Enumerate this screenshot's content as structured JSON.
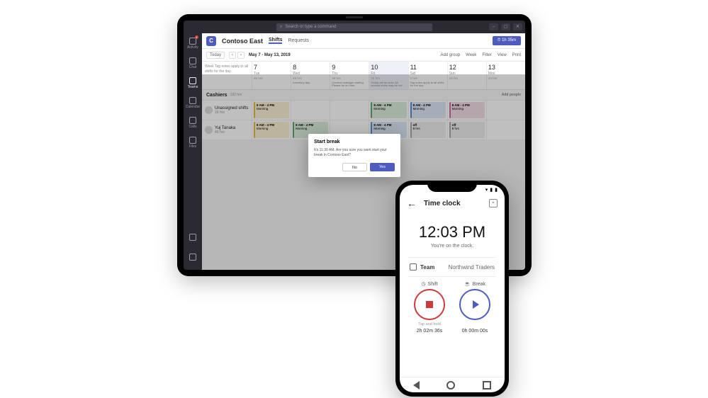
{
  "titlebar": {
    "search_placeholder": "Search or type a command"
  },
  "rail": {
    "items": [
      "Activity",
      "Chat",
      "Teams",
      "Calendar",
      "Calls",
      "Files"
    ],
    "badge": "1"
  },
  "header": {
    "team_initial": "C",
    "team_name": "Contoso East",
    "tabs": [
      "Shifts",
      "Requests"
    ],
    "clock_btn": "⏱ 1h 35m"
  },
  "toolbar": {
    "today": "Today",
    "date_range": "May 7 - May 13, 2019",
    "right": [
      "Add group",
      "Week",
      "Filter",
      "View",
      "Print"
    ]
  },
  "days_label": "Week\nTag notes apply to all shifts for the day",
  "days": [
    {
      "n": "7",
      "w": "Tue",
      "hrs": "48 hrs",
      "note": ""
    },
    {
      "n": "8",
      "w": "Wed",
      "hrs": "48 hrs",
      "note": "Inventory day."
    },
    {
      "n": "9",
      "w": "Thu",
      "hrs": "48 hrs",
      "note": "General manager visiting. Please be on time."
    },
    {
      "n": "10",
      "w": "Fri",
      "hrs": "32 hrs",
      "note": "Today will be slow. All second shifts may be cut.",
      "sel": true
    },
    {
      "n": "11",
      "w": "Sat",
      "hrs": "0 hrs",
      "note": "Tag notes apply to all shifts for the day"
    },
    {
      "n": "12",
      "w": "Sun",
      "hrs": "24 hrs",
      "note": ""
    },
    {
      "n": "13",
      "w": "Mon",
      "hrs": "24 hrs",
      "note": ""
    }
  ],
  "group": {
    "name": "Cashiers",
    "hours": "192 hrs",
    "add": "Add people"
  },
  "rows": [
    {
      "label": "Unassigned shifts",
      "sub": "16 hrs",
      "cells": [
        {
          "t": "8 AM - 4 PM",
          "s": "Morning",
          "c": "s-yellow"
        },
        null,
        null,
        {
          "t": "8 AM - 4 PM",
          "s": "Morning",
          "c": "s-green"
        },
        {
          "t": "8 AM - 4 PM",
          "s": "Morning",
          "c": "s-blue"
        },
        {
          "t": "8 AM - 4 PM",
          "s": "Morning",
          "c": "s-pink"
        },
        null
      ]
    },
    {
      "label": "Yuj Tanaka",
      "sub": "40 hrs",
      "cells": [
        {
          "t": "8 AM - 4 PM",
          "s": "Morning",
          "c": "s-yellow"
        },
        {
          "t": "8 AM - 4 PM",
          "s": "Morning",
          "c": "s-green"
        },
        null,
        {
          "t": "8 AM - 4 PM",
          "s": "Morning",
          "c": "s-blue"
        },
        {
          "t": "off",
          "s": "8 hrs",
          "c": "s-gray"
        },
        {
          "t": "off",
          "s": "8 hrs",
          "c": "s-gray"
        },
        null
      ]
    }
  ],
  "modal": {
    "title": "Start break",
    "body": "It's 11:30 AM. Are you sure you want start your break in Contoso East?",
    "no": "No",
    "yes": "Yes"
  },
  "phone": {
    "title": "Time clock",
    "time": "12:03 PM",
    "subtitle": "You're on the clock.",
    "team_label": "Team",
    "team_value": "Northwind Traders",
    "shift_label": "Shift",
    "break_label": "Break",
    "tap_hint": "Tap and hold",
    "shift_duration": "2h 02m 36s",
    "break_duration": "0h 00m 00s"
  }
}
